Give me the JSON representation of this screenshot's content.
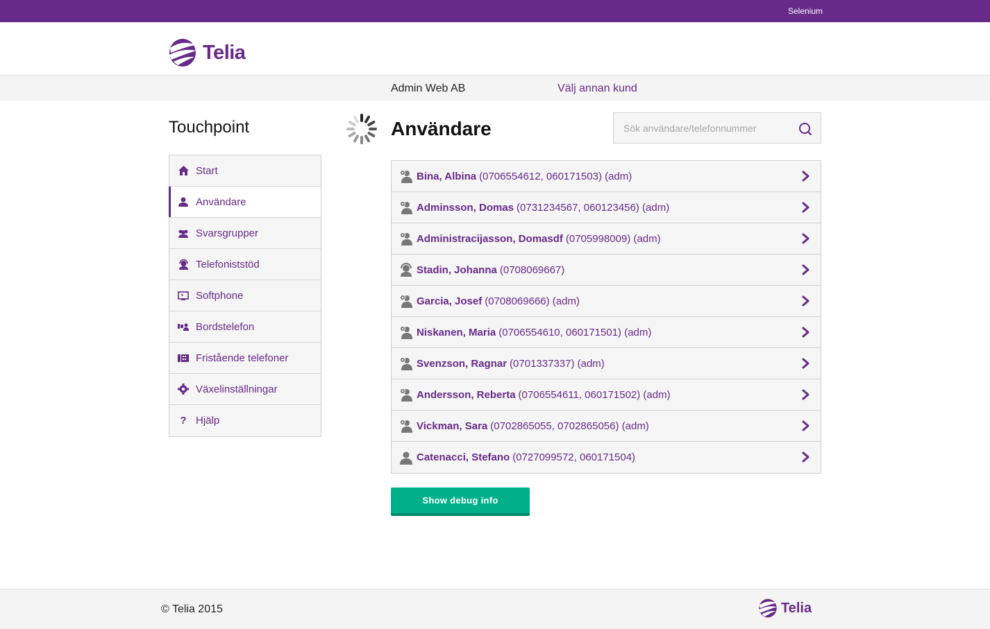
{
  "topbar": {
    "user": "Selenium"
  },
  "brand": {
    "name": "Telia",
    "color": "#662a88"
  },
  "customer": {
    "name": "Admin Web AB",
    "change_link": "Välj annan kund"
  },
  "sidebar": {
    "title": "Touchpoint",
    "items": [
      {
        "label": "Start",
        "icon": "home-icon",
        "active": false
      },
      {
        "label": "Användare",
        "icon": "user-icon",
        "active": true
      },
      {
        "label": "Svarsgrupper",
        "icon": "group-icon",
        "active": false
      },
      {
        "label": "Telefoniststöd",
        "icon": "headset-icon",
        "active": false
      },
      {
        "label": "Softphone",
        "icon": "softphone-icon",
        "active": false
      },
      {
        "label": "Bordstelefon",
        "icon": "deskphone-icon",
        "active": false
      },
      {
        "label": "Fristående telefoner",
        "icon": "standalone-phone-icon",
        "active": false
      },
      {
        "label": "Växelinställningar",
        "icon": "gear-icon",
        "active": false
      },
      {
        "label": "Hjälp",
        "icon": "help-icon",
        "active": false
      }
    ]
  },
  "main": {
    "title": "Användare",
    "search": {
      "placeholder": "Sök användare/telefonnummer"
    },
    "users": [
      {
        "name": "Bina, Albina",
        "detail": "(0706554612, 060171503) (adm)",
        "icon": "admin-user-icon"
      },
      {
        "name": "Adminsson, Domas",
        "detail": "(0731234567, 060123456) (adm)",
        "icon": "admin-user-icon"
      },
      {
        "name": "Administracijasson, Domasdf",
        "detail": "(0705998009) (adm)",
        "icon": "admin-user-icon"
      },
      {
        "name": "Stadin, Johanna",
        "detail": "(0708069667)",
        "icon": "operator-user-icon"
      },
      {
        "name": "Garcia, Josef",
        "detail": "(0708069666) (adm)",
        "icon": "admin-user-icon"
      },
      {
        "name": "Niskanen, Maria",
        "detail": "(0706554610, 060171501) (adm)",
        "icon": "admin-user-icon"
      },
      {
        "name": "Svenzson, Ragnar",
        "detail": "(0701337337) (adm)",
        "icon": "admin-user-icon"
      },
      {
        "name": "Andersson, Reberta",
        "detail": "(0706554611, 060171502) (adm)",
        "icon": "admin-user-icon"
      },
      {
        "name": "Vickman, Sara",
        "detail": "(0702865055, 0702865056) (adm)",
        "icon": "admin-user-icon"
      },
      {
        "name": "Catenacci, Stefano",
        "detail": "(0727099572, 060171504)",
        "icon": "user-icon"
      }
    ],
    "debug_button": "Show debug info"
  },
  "footer": {
    "copyright": "© Telia 2015",
    "logo_text": "Telia"
  }
}
